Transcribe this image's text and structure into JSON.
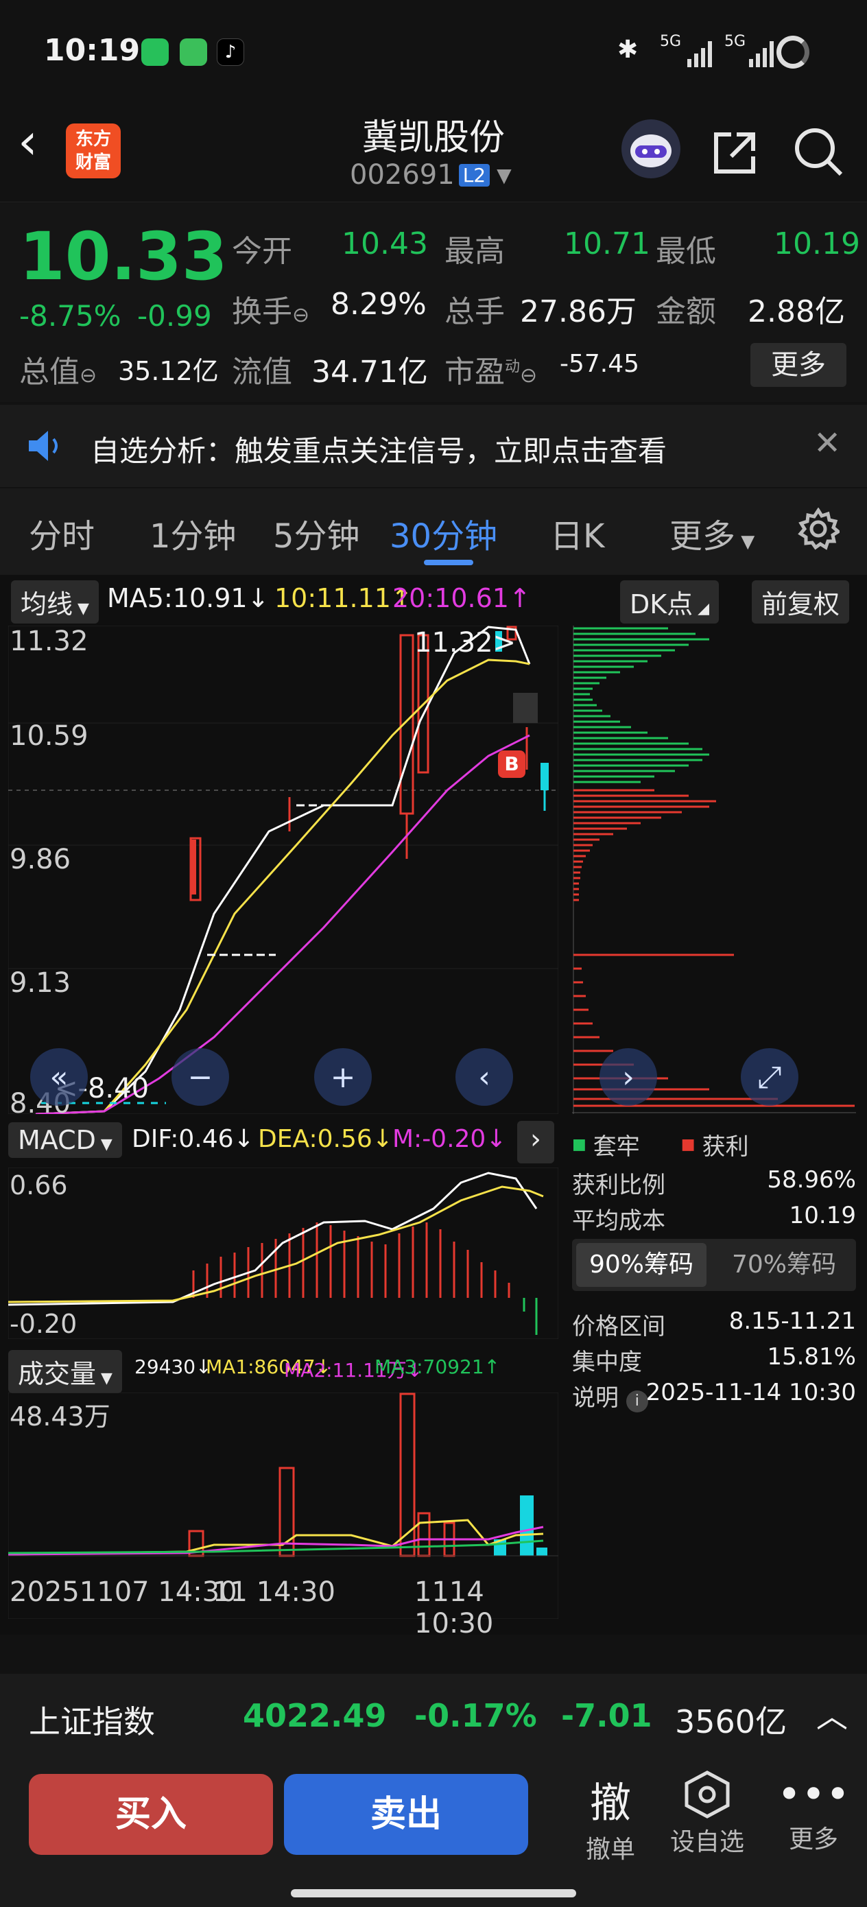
{
  "status_bar": {
    "time": "10:19",
    "net1": "5G",
    "net2": "5G"
  },
  "header": {
    "title": "冀凯股份",
    "code": "002691",
    "level_badge": "L2",
    "logo_line1": "东方",
    "logo_line2": "财富"
  },
  "quote": {
    "price": "10.33",
    "change_pct": "-8.75%",
    "change": "-0.99",
    "open_label": "今开",
    "open": "10.43",
    "high_label": "最高",
    "high": "10.71",
    "low_label": "最低",
    "low": "10.19",
    "turnover_label": "换手",
    "turnover": "8.29%",
    "volume_label": "总手",
    "volume": "27.86万",
    "amount_label": "金额",
    "amount": "2.88亿",
    "mktcap_label": "总值",
    "mktcap": "35.12亿",
    "float_label": "流值",
    "float": "34.71亿",
    "pe_label": "市盈",
    "pe_sup": "动",
    "pe": "-57.45",
    "more_label": "更多"
  },
  "notice": {
    "text": "自选分析：触发重点关注信号，立即点击查看"
  },
  "tabs": [
    {
      "label": "分时"
    },
    {
      "label": "1分钟"
    },
    {
      "label": "5分钟"
    },
    {
      "label": "30分钟"
    },
    {
      "label": "日K"
    },
    {
      "label": "更多"
    }
  ],
  "ma_bar": {
    "type_label": "均线",
    "ma5": "MA5:10.91",
    "ma10": "10:11.11",
    "ma20": "20:10.61",
    "dk_label": "DK点",
    "fq_label": "前复权"
  },
  "kline": {
    "y_ticks": [
      "11.32",
      "10.59",
      "9.86",
      "9.13",
      "8.40"
    ],
    "high_marker": "11.32",
    "low_marker": "8.40",
    "b_marker": "B"
  },
  "macd": {
    "label": "MACD",
    "dif": "DIF:0.46",
    "dea": "DEA:0.56",
    "m": "M:-0.20",
    "y_top": "0.66",
    "y_bottom": "-0.20"
  },
  "volume": {
    "label": "成交量",
    "v": "29430",
    "ma1": "MA1:86047",
    "ma2": "MA2:11.11万",
    "ma3": "MA3:70921",
    "y_top": "48.43万"
  },
  "x_axis": {
    "left": "20251107 14:30",
    "mid": "11 14:30",
    "right": "1114 10:30"
  },
  "chips": {
    "legend_trapped": "套牢",
    "legend_profit": "获利",
    "profit_ratio_label": "获利比例",
    "profit_ratio": "58.96%",
    "avg_cost_label": "平均成本",
    "avg_cost": "10.19",
    "tab90": "90%筹码",
    "tab70": "70%筹码",
    "range_label": "价格区间",
    "range": "8.15-11.21",
    "concentration_label": "集中度",
    "concentration": "15.81%",
    "note_label": "说明",
    "note": "2025-11-14 10:30"
  },
  "index_bar": {
    "name": "上证指数",
    "value": "4022.49",
    "pct": "-0.17%",
    "change": "-7.01",
    "amount": "3560亿"
  },
  "bottom": {
    "buy": "买入",
    "sell": "卖出",
    "cancel_icon": "撤",
    "cancel": "撤单",
    "watch": "设自选",
    "more": "更多"
  },
  "colors": {
    "up": "#e5392f",
    "down": "#20c35a",
    "accent": "#4a8ff5",
    "buy_bg": "#c0433f",
    "sell_bg": "#2f6ad8"
  }
}
